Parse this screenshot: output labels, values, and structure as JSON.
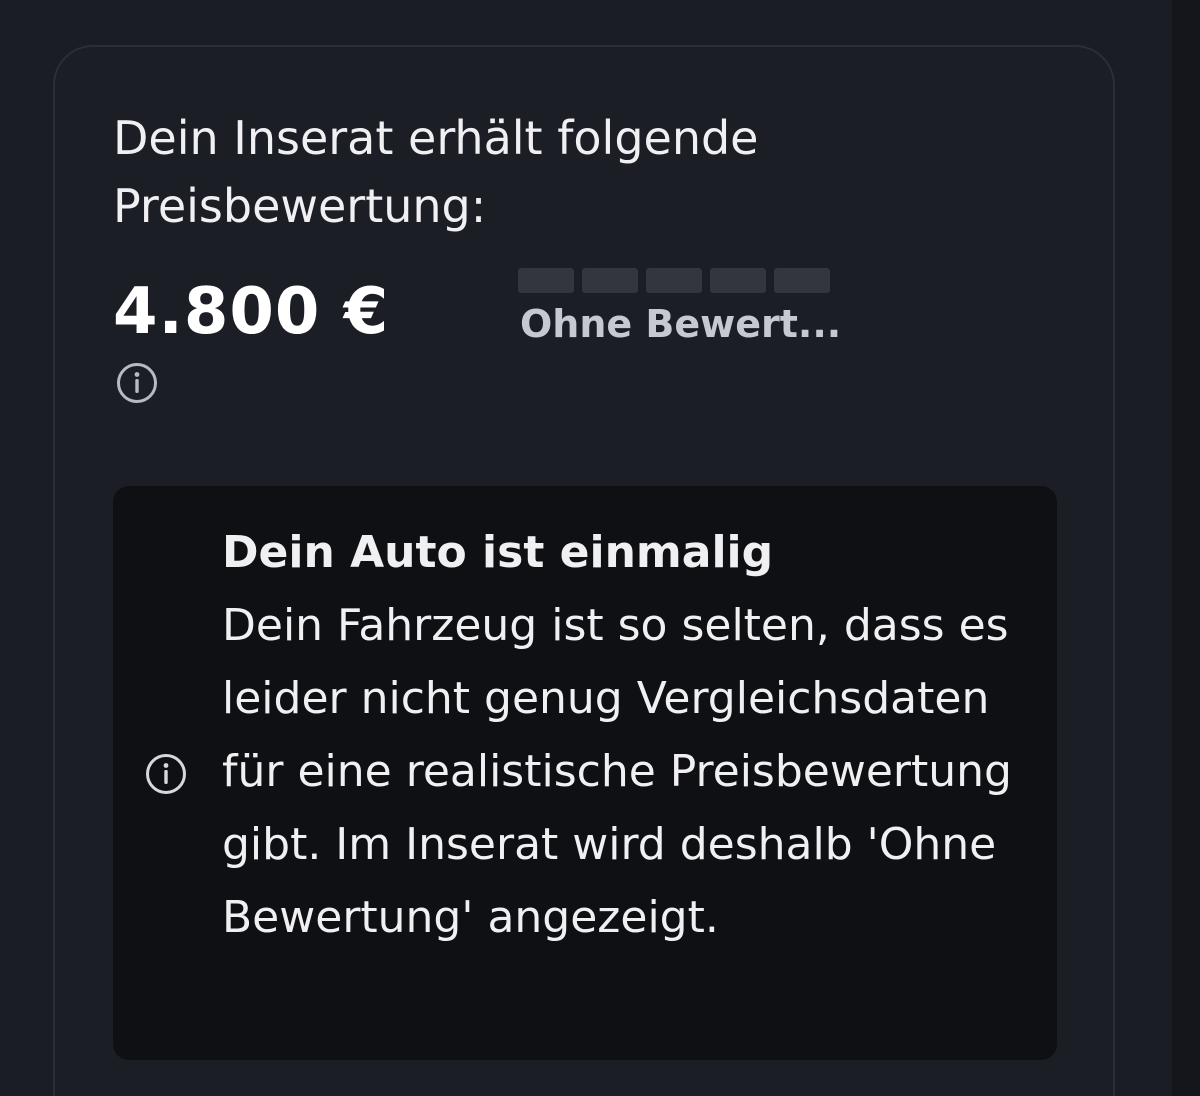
{
  "headline": "Dein Inserat erhält folgende Preisbewertung:",
  "price": "4.800 €",
  "rating": {
    "label": "Ohne Bewert...",
    "filled_segments": 0,
    "total_segments": 5
  },
  "notice": {
    "title": "Dein Auto ist einmalig",
    "body": "Dein Fahrzeug ist so selten, dass es leider nicht genug Vergleichsdaten für eine realistische Preisbewertung gibt. Im Inserat wird deshalb 'Ohne Bewertung' angezeigt."
  },
  "icons": {
    "price_info": "info-icon",
    "notice_info": "info-icon"
  },
  "colors": {
    "background": "#1b1d25",
    "card_border": "#2b2e37",
    "notice_background": "#0f1014",
    "rating_segment": "#33363f",
    "text": "#f0f0f3",
    "muted_text": "#c7c9d0"
  }
}
